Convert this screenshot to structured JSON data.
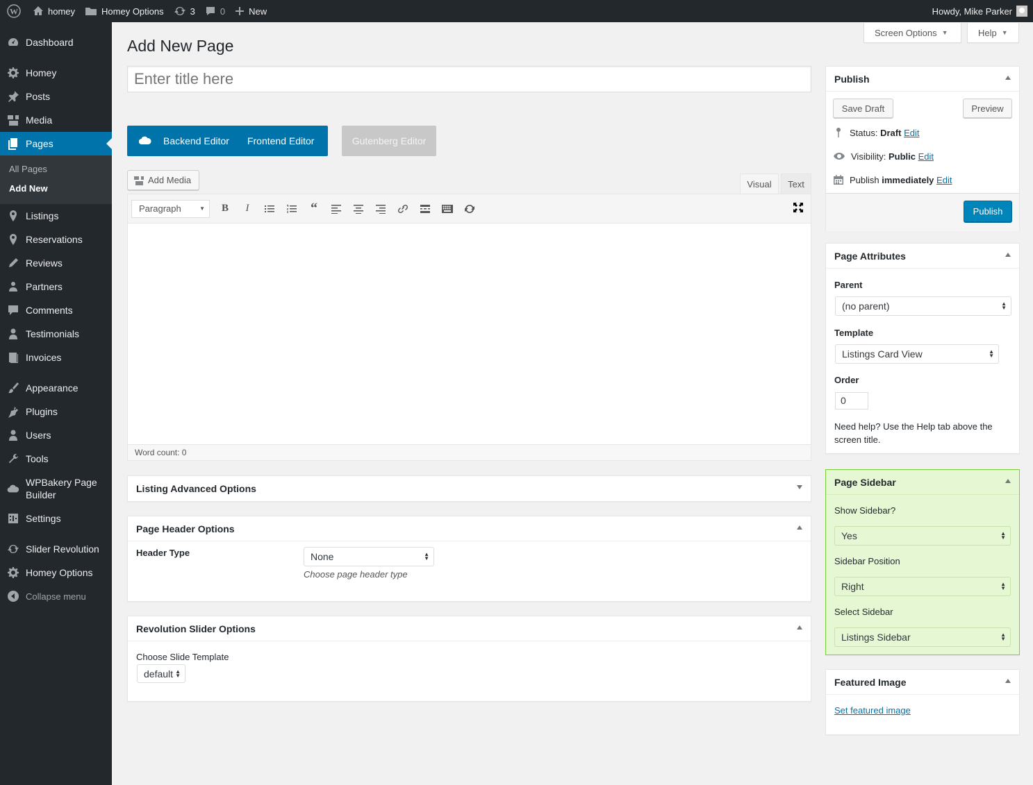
{
  "admin_bar": {
    "site_name": "homey",
    "theme_options": "Homey Options",
    "updates_count": "3",
    "comments_count": "0",
    "new_label": "New",
    "howdy": "Howdy, Mike Parker"
  },
  "sidebar": {
    "items": [
      {
        "label": "Dashboard",
        "icon": "dashboard-icon"
      },
      {
        "label": "Homey",
        "icon": "gear-icon"
      },
      {
        "label": "Posts",
        "icon": "pin-icon"
      },
      {
        "label": "Media",
        "icon": "media-icon"
      },
      {
        "label": "Pages",
        "icon": "pages-icon"
      },
      {
        "label": "Listings",
        "icon": "location-icon"
      },
      {
        "label": "Reservations",
        "icon": "location-icon"
      },
      {
        "label": "Reviews",
        "icon": "pencil-icon"
      },
      {
        "label": "Partners",
        "icon": "partners-icon"
      },
      {
        "label": "Comments",
        "icon": "comment-icon"
      },
      {
        "label": "Testimonials",
        "icon": "user-icon"
      },
      {
        "label": "Invoices",
        "icon": "book-icon"
      },
      {
        "label": "Appearance",
        "icon": "brush-icon"
      },
      {
        "label": "Plugins",
        "icon": "plugin-icon"
      },
      {
        "label": "Users",
        "icon": "users-icon"
      },
      {
        "label": "Tools",
        "icon": "wrench-icon"
      },
      {
        "label": "WPBakery Page Builder",
        "icon": "cloud-icon"
      },
      {
        "label": "Settings",
        "icon": "settings-icon"
      },
      {
        "label": "Slider Revolution",
        "icon": "refresh-icon"
      },
      {
        "label": "Homey Options",
        "icon": "gear-icon"
      }
    ],
    "submenu": [
      "All Pages",
      "Add New"
    ],
    "collapse": "Collapse menu"
  },
  "screen_options": "Screen Options",
  "help": "Help",
  "page_title": "Add New Page",
  "title_placeholder": "Enter title here",
  "builder": {
    "backend": "Backend Editor",
    "frontend": "Frontend Editor",
    "gutenberg": "Gutenberg Editor"
  },
  "editor": {
    "add_media": "Add Media",
    "tab_visual": "Visual",
    "tab_text": "Text",
    "format": "Paragraph",
    "word_count": "Word count: 0"
  },
  "listing_advanced": {
    "title": "Listing Advanced Options"
  },
  "page_header": {
    "title": "Page Header Options",
    "label": "Header Type",
    "value": "None",
    "hint": "Choose page header type"
  },
  "rev_slider": {
    "title": "Revolution Slider Options",
    "label": "Choose Slide Template",
    "value": "default"
  },
  "publish": {
    "title": "Publish",
    "save_draft": "Save Draft",
    "preview": "Preview",
    "status_label": "Status:",
    "status_value": "Draft",
    "visibility_label": "Visibility:",
    "visibility_value": "Public",
    "publish_label": "Publish",
    "publish_value": "immediately",
    "edit": "Edit",
    "publish_button": "Publish"
  },
  "attributes": {
    "title": "Page Attributes",
    "parent_label": "Parent",
    "parent_value": "(no parent)",
    "template_label": "Template",
    "template_value": "Listings Card View",
    "order_label": "Order",
    "order_value": "0",
    "help": "Need help? Use the Help tab above the screen title."
  },
  "page_sidebar": {
    "title": "Page Sidebar",
    "show_label": "Show Sidebar?",
    "show_value": "Yes",
    "position_label": "Sidebar Position",
    "position_value": "Right",
    "select_label": "Select Sidebar",
    "select_value": "Listings Sidebar"
  },
  "featured": {
    "title": "Featured Image",
    "link": "Set featured image"
  }
}
